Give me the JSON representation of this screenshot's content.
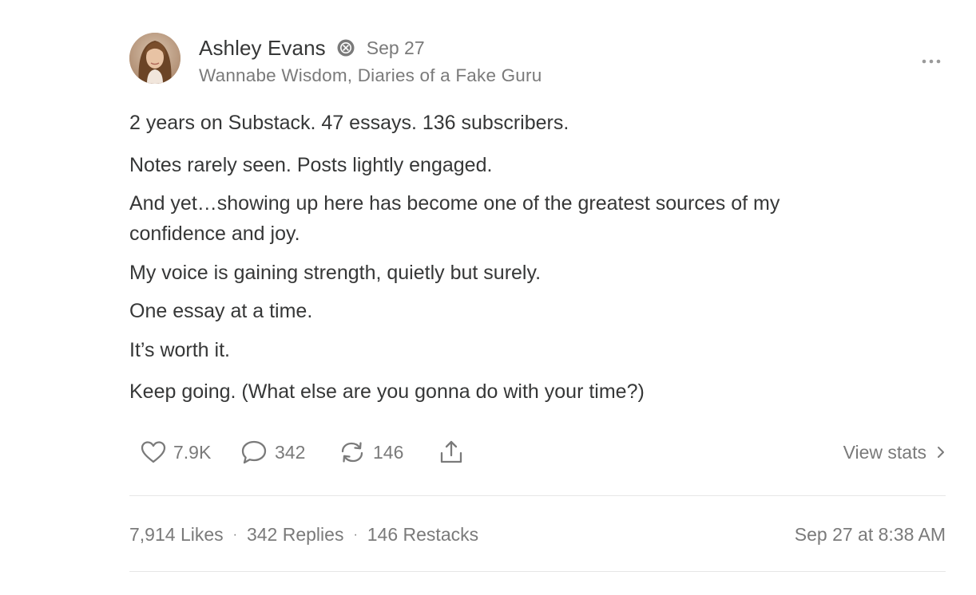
{
  "author": {
    "name": "Ashley Evans",
    "publication": "Wannabe Wisdom, Diaries of a Fake Guru",
    "date": "Sep 27",
    "badge_icon": "substack-badge-icon"
  },
  "post": {
    "paragraphs": [
      "2 years on Substack. 47 essays. 136 subscribers.",
      "Notes rarely seen. Posts lightly engaged.",
      "And yet…showing up here has become one of the greatest sources of my confidence and joy.",
      "My voice is gaining strength, quietly but surely.",
      "One essay at a time.",
      "It’s worth it.",
      "Keep going. (What else are you gonna do with your time?)"
    ]
  },
  "actions": {
    "likes": "7.9K",
    "replies": "342",
    "restacks": "146",
    "view_stats": "View stats"
  },
  "stats": {
    "likes": "7,914 Likes",
    "replies": "342 Replies",
    "restacks": "146 Restacks",
    "separator": "·",
    "timestamp": "Sep 27 at 8:38 AM"
  },
  "colors": {
    "text": "#363737",
    "muted": "#7a7a7a",
    "divider": "#e6e6e6"
  }
}
